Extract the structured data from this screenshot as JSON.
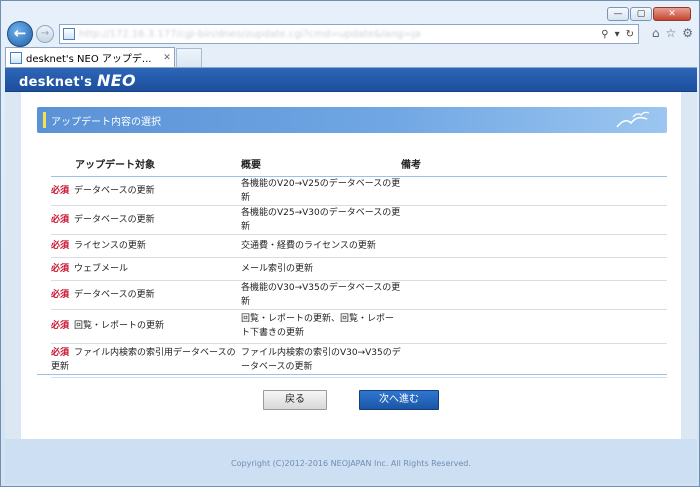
{
  "browser": {
    "address_url": "http://172.16.3.177/cgi-bin/dneo/zupdate.cgi?cmd=update&lang=ja",
    "tab_title": "desknet's NEO アップデ...",
    "tab_close": "✕",
    "controls": {
      "minimize": "—",
      "maximize": "▢",
      "close": "✕"
    },
    "icons": [
      "home-icon",
      "star-icon",
      "gear-icon"
    ]
  },
  "app": {
    "logo_prefix": "desknet's",
    "logo_main": "NEO"
  },
  "section": {
    "title": "アップデート内容の選択"
  },
  "table": {
    "headers": {
      "target": "アップデート対象",
      "summary": "概要",
      "notes": "備考"
    },
    "required_label": "必須",
    "rows": [
      {
        "target": "データベースの更新",
        "summary": "各機能のV20→V25のデータベースの更新",
        "notes": ""
      },
      {
        "target": "データベースの更新",
        "summary": "各機能のV25→V30のデータベースの更新",
        "notes": ""
      },
      {
        "target": "ライセンスの更新",
        "summary": "交通費・経費のライセンスの更新",
        "notes": ""
      },
      {
        "target": "ウェブメール",
        "summary": "メール索引の更新",
        "notes": ""
      },
      {
        "target": "データベースの更新",
        "summary": "各機能のV30→V35のデータベースの更新",
        "notes": ""
      },
      {
        "target": "回覧・レポートの更新",
        "summary": "回覧・レポートの更新、回覧・レポート下書きの更新",
        "notes": ""
      },
      {
        "target": "ファイル内検索の索引用データベースの更新",
        "summary": "ファイル内検索の索引のV30→V35のデータベースの更新",
        "notes": ""
      }
    ]
  },
  "buttons": {
    "back": "戻る",
    "next": "次へ進む"
  },
  "footer": {
    "copyright": "Copyright (C)2012-2016 NEOJAPAN Inc. All Rights Reserved."
  }
}
